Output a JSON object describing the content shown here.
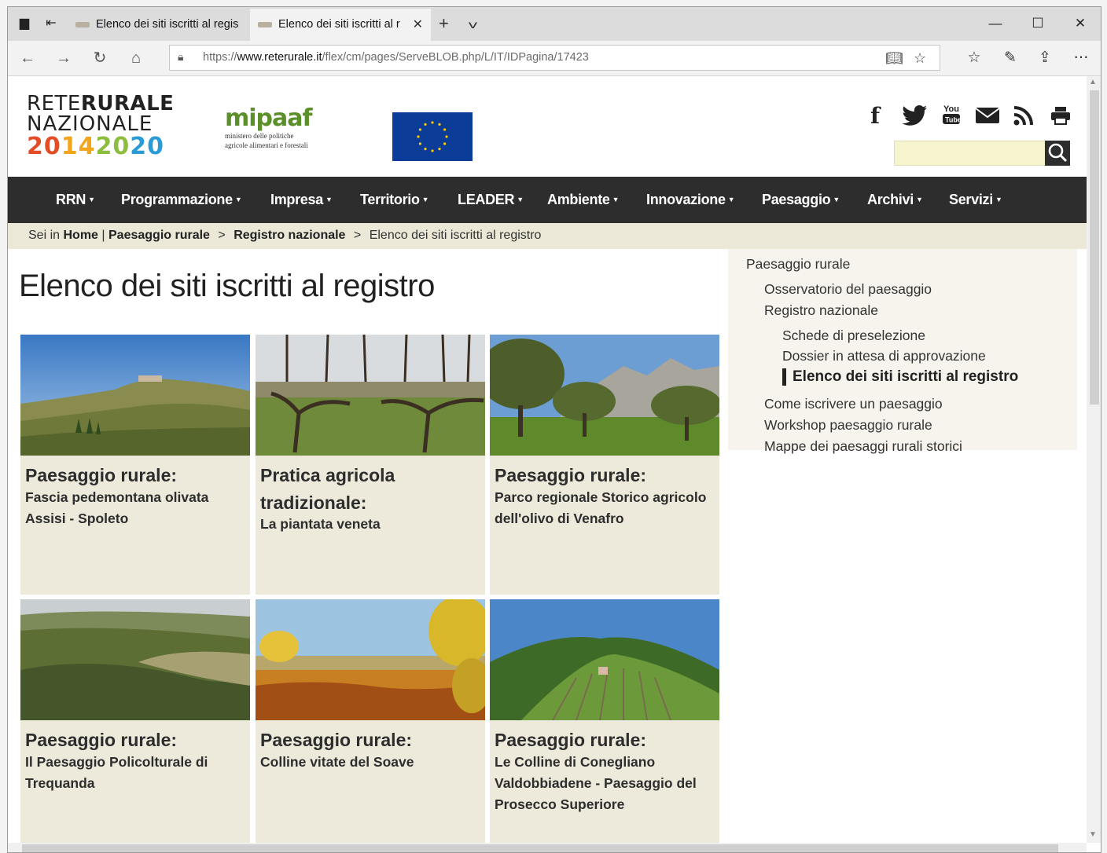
{
  "browser": {
    "tabs": [
      {
        "title": "Elenco dei siti iscritti al regis",
        "active": false
      },
      {
        "title": "Elenco dei siti iscritti al r",
        "active": true
      }
    ],
    "url_prefix": "https://",
    "url_host": "www.reterurale.it",
    "url_path": "/flex/cm/pages/ServeBLOB.php/L/IT/IDPagina/17423"
  },
  "header": {
    "logo_line1_a": "RETE",
    "logo_line1_b": "RURALE",
    "logo_line2": "NAZIONALE",
    "logo_year": [
      "20",
      "14",
      "20",
      "20"
    ],
    "mipaaf_word": "mipaaf",
    "mipaaf_sub1": "ministero delle politiche",
    "mipaaf_sub2": "agricole alimentari e forestali",
    "social": [
      {
        "name": "facebook-icon",
        "glyph": "f"
      },
      {
        "name": "twitter-icon",
        "glyph": "🐦"
      },
      {
        "name": "youtube-icon",
        "glyph": "You"
      },
      {
        "name": "mail-icon",
        "glyph": "✉"
      },
      {
        "name": "rss-icon",
        "glyph": "◔"
      },
      {
        "name": "print-icon",
        "glyph": "▀"
      }
    ]
  },
  "menu": [
    "RRN",
    "Programmazione",
    "Impresa",
    "Territorio",
    "LEADER",
    "Ambiente",
    "Innovazione",
    "Paesaggio",
    "Archivi",
    "Servizi"
  ],
  "breadcrumb": {
    "prefix": "Sei in",
    "home": "Home",
    "paesaggio": "Paesaggio rurale",
    "registro": "Registro nazionale",
    "current": "Elenco dei siti iscritti al registro",
    "sep1": "|",
    "sep2": ">"
  },
  "page_title": "Elenco dei siti iscritti al registro",
  "cards": [
    {
      "title": "Paesaggio rurale:",
      "subtitle": "Fascia pedemontana olivata Assisi - Spoleto"
    },
    {
      "title": "Pratica agricola tradizionale:",
      "subtitle": "La piantata veneta"
    },
    {
      "title": "Paesaggio rurale:",
      "subtitle": "Parco regionale Storico agricolo dell'olivo di Venafro"
    },
    {
      "title": "Paesaggio rurale:",
      "subtitle": "Il Paesaggio Policolturale di Trequanda"
    },
    {
      "title": "Paesaggio rurale:",
      "subtitle": "Colline vitate del Soave"
    },
    {
      "title": "Paesaggio rurale:",
      "subtitle": "Le Colline di Conegliano Valdobbiadene - Paesaggio del Prosecco Superiore"
    }
  ],
  "sidebar": {
    "root": "Paesaggio rurale",
    "osservatorio": "Osservatorio del paesaggio",
    "registro": "Registro nazionale",
    "schede": "Schede di preselezione",
    "dossier": "Dossier in attesa di approvazione",
    "elenco": "Elenco dei siti iscritti al registro",
    "come": "Come iscrivere un paesaggio",
    "workshop": "Workshop paesaggio rurale",
    "mappe": "Mappe dei paesaggi rurali storici"
  },
  "colors": {
    "menu_bg": "#2d2d2d",
    "card_bg": "#edeadb",
    "breadcrumb_bg": "#ebe8d7"
  }
}
